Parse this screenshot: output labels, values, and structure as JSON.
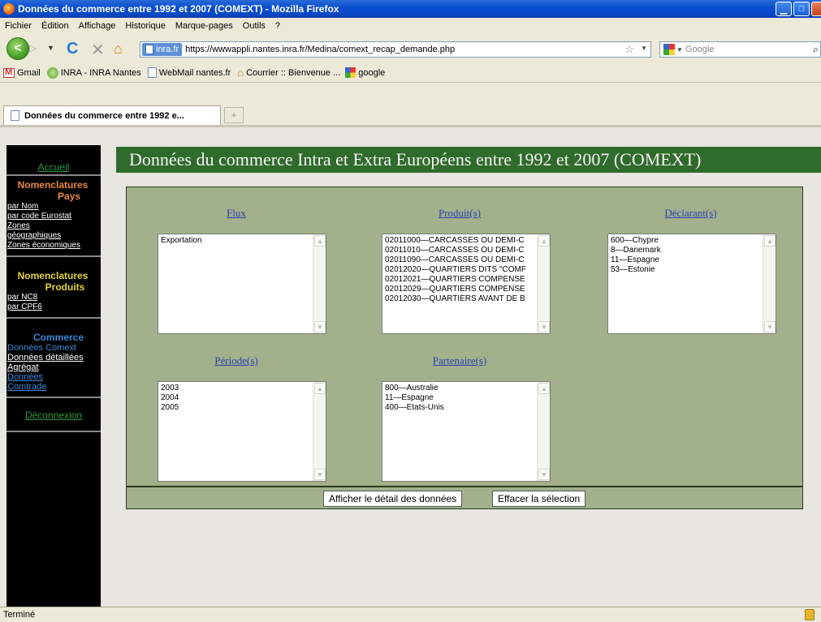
{
  "window": {
    "title": "Données du commerce entre 1992 et 2007 (COMEXT) - Mozilla Firefox"
  },
  "menu": [
    "Fichier",
    "Édition",
    "Affichage",
    "Historique",
    "Marque-pages",
    "Outils",
    "?"
  ],
  "toolbar": {
    "url_site": "inra.fr",
    "url": "https://wwwappli.nantes.inra.fr/Medina/comext_recap_demande.php",
    "search_placeholder": "Google"
  },
  "bookmarks": [
    "Gmail",
    "INRA - INRA Nantes",
    "WebMail nantes.fr",
    "Courrier :: Bienvenue ...",
    "google"
  ],
  "tab": {
    "label": "Données du commerce entre 1992 e...",
    "new_tab": "+"
  },
  "sidebar": {
    "accueil": "Accueil",
    "sections": [
      {
        "heading": [
          "Nomenclatures",
          "Pays"
        ],
        "links": [
          "par Nom",
          "par code Eurostat",
          "Zones",
          "géographiques",
          "Zones économiques"
        ]
      },
      {
        "heading": [
          "Nomenclatures",
          "Produits"
        ],
        "links": [
          "par NC8",
          "par CPF6"
        ]
      },
      {
        "heading": [
          "Commerce"
        ],
        "links": [
          "Données Comext",
          "Données détaillées",
          "Agrégat",
          "Données",
          "Comtrade"
        ]
      }
    ],
    "logout": "Déconnexion"
  },
  "banner": {
    "title": "Données du commerce Intra et Extra Européens entre 1992 et 2007 (COMEXT)"
  },
  "form": {
    "flux": {
      "label": "Flux",
      "options": [
        "Exportation"
      ]
    },
    "produits": {
      "label": "Produit(s)",
      "options": [
        "02011000—CARCASSES OU DEMI-C",
        "02011010—CARCASSES OU DEMI-C",
        "02011090—CARCASSES OU DEMI-C",
        "02012020—QUARTIERS DITS \"COMF",
        "02012021—QUARTIERS COMPENSE",
        "02012029—QUARTIERS COMPENSE",
        "02012030—QUARTIERS AVANT DE B"
      ]
    },
    "declarants": {
      "label": "Déclarant(s)",
      "options": [
        "600—Chypre",
        "8—Danemark",
        "11—Espagne",
        "53—Estonie"
      ]
    },
    "periode": {
      "label": "Période(s)",
      "options": [
        "2003",
        "2004",
        "2005"
      ]
    },
    "partenaires": {
      "label": "Partenaire(s)",
      "options": [
        "800—Australie",
        "11—Espagne",
        "400—Etats-Unis"
      ]
    },
    "buttons": {
      "show": "Afficher le détail des données",
      "clear": "Effacer la sélection"
    }
  },
  "status": {
    "text": "Terminé"
  }
}
